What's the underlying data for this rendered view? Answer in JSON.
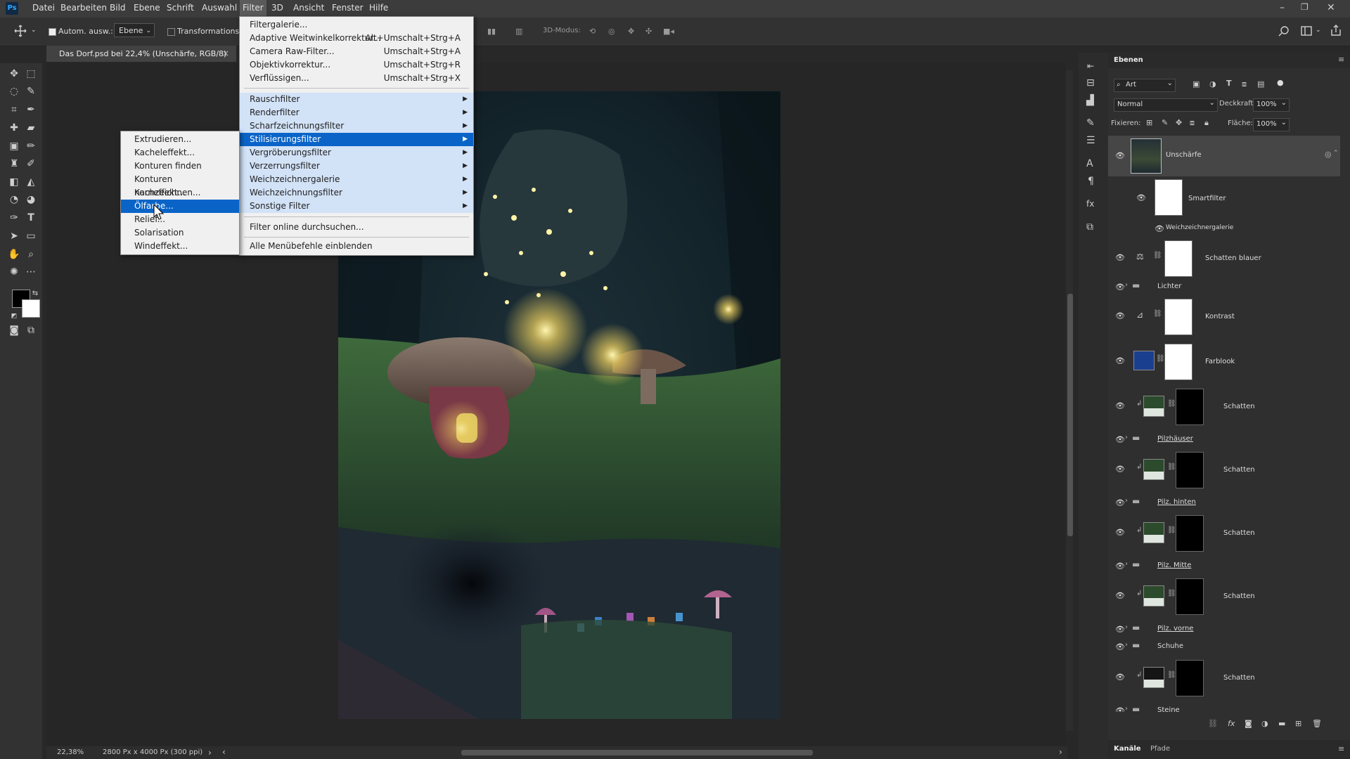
{
  "menubar": {
    "items": [
      "Datei",
      "Bearbeiten",
      "Bild",
      "Ebene",
      "Schrift",
      "Auswahl",
      "Filter",
      "3D",
      "Ansicht",
      "Fenster",
      "Hilfe"
    ],
    "active": "Filter"
  },
  "options": {
    "auto_select_label": "Autom. ausw.:",
    "auto_select_value": "Ebene",
    "transform_label": "Transformationsstrg.",
    "mode_3d_label": "3D-Modus:"
  },
  "document": {
    "tab_title": "Das Dorf.psd bei 22,4% (Unschärfe, RGB/8)",
    "close": "×"
  },
  "status": {
    "zoom": "22,38%",
    "size": "2800 Px x 4000 Px (300 ppi)",
    "arrow": "›"
  },
  "filter_menu": {
    "items": [
      {
        "label": "Filtergalerie...",
        "shortcut": ""
      },
      {
        "label": "Adaptive Weitwinkelkorrektur...",
        "shortcut": "Alt+Umschalt+Strg+A"
      },
      {
        "label": "Camera Raw-Filter...",
        "shortcut": "Umschalt+Strg+A"
      },
      {
        "label": "Objektivkorrektur...",
        "shortcut": "Umschalt+Strg+R"
      },
      {
        "label": "Verflüssigen...",
        "shortcut": "Umschalt+Strg+X"
      }
    ],
    "submenus": [
      "Rauschfilter",
      "Renderfilter",
      "Scharfzeichnungsfilter",
      "Stilisierungsfilter",
      "Vergröberungsfilter",
      "Verzerrungsfilter",
      "Weichzeichnergalerie",
      "Weichzeichnungsfilter",
      "Sonstige Filter"
    ],
    "highlighted_submenu": "Stilisierungsfilter",
    "online": "Filter online durchsuchen...",
    "show_all": "Alle Menübefehle einblenden"
  },
  "stylize_menu": {
    "items": [
      "Extrudieren...",
      "Kacheleffekt...",
      "Konturen finden",
      "Konturen nachzeichnen...",
      "Korneffekt...",
      "Ölfarbe...",
      "Relief...",
      "Solarisation",
      "Windeffekt..."
    ],
    "highlighted": "Ölfarbe..."
  },
  "layers_panel": {
    "tab": "Ebenen",
    "filter_kind": "Art",
    "blend_mode": "Normal",
    "opacity_label": "Deckkraft:",
    "opacity_value": "100%",
    "lock_label": "Fixieren:",
    "fill_label": "Fläche:",
    "fill_value": "100%",
    "layers": [
      {
        "name": "Unschärfe",
        "kind": "smart"
      },
      {
        "name": "Smartfilter",
        "kind": "filter-mask"
      },
      {
        "name": "Weichzeichnergalerie",
        "kind": "filter"
      },
      {
        "name": "Schatten blauer",
        "kind": "adjustment"
      },
      {
        "name": "Lichter",
        "kind": "group"
      },
      {
        "name": "Kontrast",
        "kind": "adjustment"
      },
      {
        "name": "Farblook",
        "kind": "fill"
      },
      {
        "name": "Schatten",
        "kind": "clipped"
      },
      {
        "name": "Pilzhäuser",
        "kind": "group"
      },
      {
        "name": "Schatten",
        "kind": "clipped"
      },
      {
        "name": "Pilz. hinten",
        "kind": "group"
      },
      {
        "name": "Schatten",
        "kind": "clipped"
      },
      {
        "name": "Pilz. Mitte",
        "kind": "group"
      },
      {
        "name": "Schatten",
        "kind": "clipped"
      },
      {
        "name": "Pilz. vorne",
        "kind": "group"
      },
      {
        "name": "Schuhe",
        "kind": "group"
      },
      {
        "name": "Schatten",
        "kind": "clipped"
      },
      {
        "name": "Steine",
        "kind": "group"
      }
    ],
    "bottom_tabs": [
      "Kanäle",
      "Pfade"
    ],
    "fx": "fx"
  },
  "colors": {
    "selection": "#0a64c8",
    "submenu_highlight": "#d2e2f7",
    "farblook_swatch": "#1b3f8f"
  }
}
